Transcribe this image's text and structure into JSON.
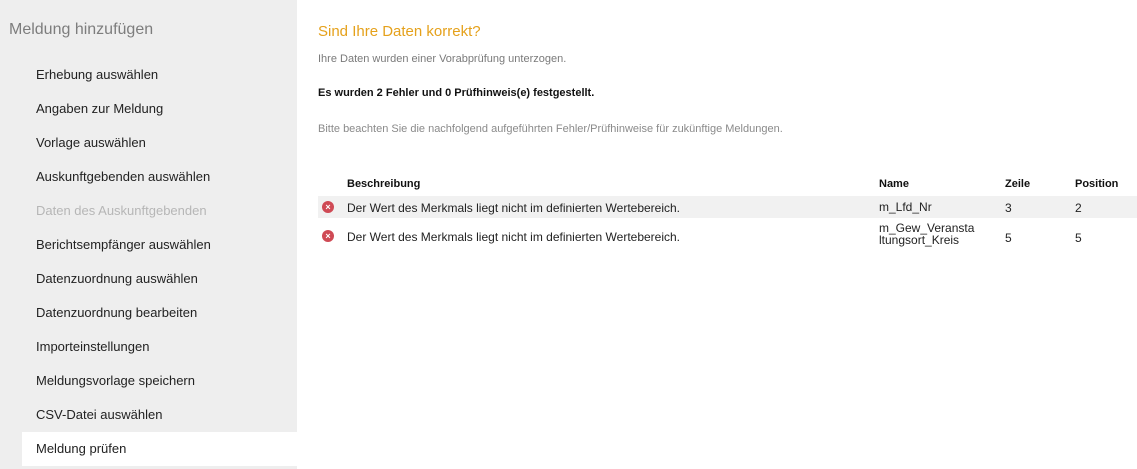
{
  "sidebar": {
    "title": "Meldung hinzufügen",
    "items": [
      {
        "label": "Erhebung auswählen"
      },
      {
        "label": "Angaben zur Meldung"
      },
      {
        "label": "Vorlage auswählen"
      },
      {
        "label": "Auskunftgebenden auswählen"
      },
      {
        "label": "Daten des Auskunftgebenden"
      },
      {
        "label": "Berichtsempfänger auswählen"
      },
      {
        "label": "Datenzuordnung auswählen"
      },
      {
        "label": "Datenzuordnung bearbeiten"
      },
      {
        "label": "Importeinstellungen"
      },
      {
        "label": "Meldungsvorlage speichern"
      },
      {
        "label": "CSV-Datei auswählen"
      },
      {
        "label": "Meldung prüfen"
      }
    ]
  },
  "main": {
    "title": "Sind Ihre Daten korrekt?",
    "subtitle": "Ihre Daten wurden einer Vorabprüfung unterzogen.",
    "summary": "Es wurden 2 Fehler und 0 Prüfhinweis(e) festgestellt.",
    "hint": "Bitte beachten Sie die nachfolgend aufgeführten Fehler/Prüfhinweise für zukünftige Meldungen."
  },
  "table": {
    "headers": {
      "description": "Beschreibung",
      "name": "Name",
      "zeile": "Zeile",
      "position": "Position"
    },
    "rows": [
      {
        "icon": "error-icon",
        "description": "Der Wert des Merkmals liegt nicht im definierten Wertebereich.",
        "name": "m_Lfd_Nr",
        "zeile": "3",
        "position": "2"
      },
      {
        "icon": "error-icon",
        "description": "Der Wert des Merkmals liegt nicht im definierten Wertebereich.",
        "name": "m_Gew_Veranstaltungsort_Kreis",
        "name_line1": "m_Gew_Veransta",
        "name_line2": "ltungsort_Kreis",
        "zeile": "5",
        "position": "5"
      }
    ]
  },
  "colors": {
    "accent": "#e5a11b",
    "error": "#cf4a55",
    "sidebar_bg": "#eeeeee"
  }
}
